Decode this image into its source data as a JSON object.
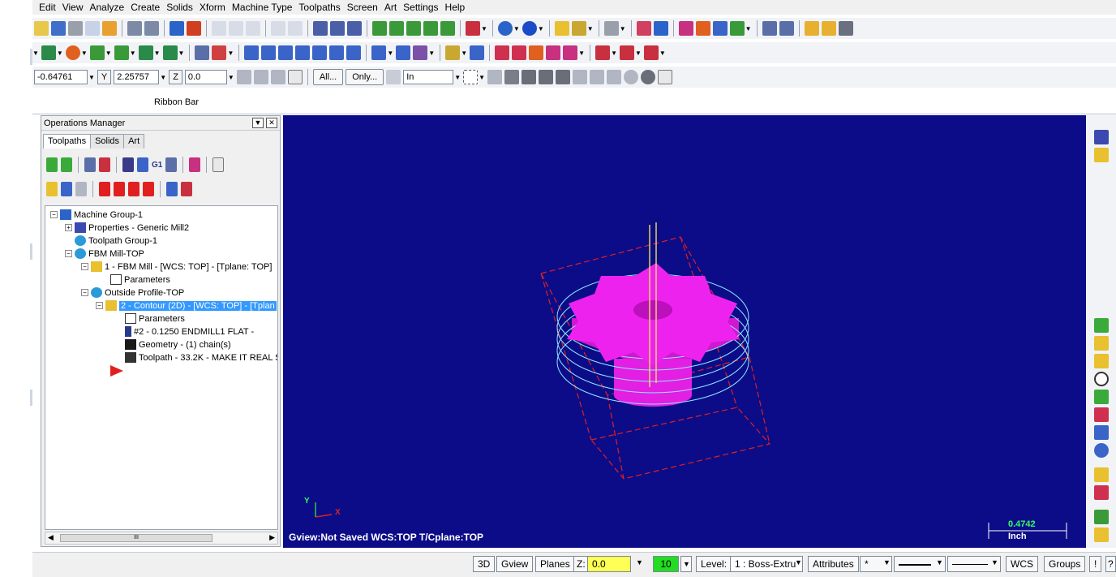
{
  "menu": [
    "Edit",
    "View",
    "Analyze",
    "Create",
    "Solids",
    "Xform",
    "Machine Type",
    "Toolpaths",
    "Screen",
    "Art",
    "Settings",
    "Help"
  ],
  "coords": {
    "x": "-0.64761",
    "y_label": "Y",
    "y": "2.25757",
    "z_label": "Z",
    "z": "0.0"
  },
  "ribbon": {
    "all_button": "All...",
    "only_button": "Only...",
    "select_mode": "In",
    "label": "Ribbon Bar"
  },
  "ops_manager": {
    "title": "Operations Manager",
    "tabs": [
      "Toolpaths",
      "Solids",
      "Art"
    ],
    "icon_g1": "G1",
    "tree": {
      "machine_group": "Machine Group-1",
      "properties": "Properties - Generic Mill2",
      "toolpath_group": "Toolpath Group-1",
      "fbm_mill_top": "FBM Mill-TOP",
      "op1": "1 - FBM Mill - [WCS: TOP] - [Tplane: TOP]",
      "op1_params": "Parameters",
      "outside_profile": "Outside Profile-TOP",
      "op2": "2 - Contour (2D) - [WCS: TOP] - [Tplan",
      "op2_params": "Parameters",
      "op2_tool": "#2 - 0.1250 ENDMILL1 FLAT -",
      "op2_geometry": "Geometry - (1) chain(s)",
      "op2_toolpath": "Toolpath - 33.2K - MAKE IT REAL S"
    },
    "scroll_mark": "III"
  },
  "viewport": {
    "gview": "Gview:Not Saved   WCS:TOP   T/Cplane:TOP",
    "axis_x": "X",
    "axis_y": "Y",
    "scale_value": "0.4742",
    "scale_unit": "Inch"
  },
  "status": {
    "btn_3d": "3D",
    "btn_gview": "Gview",
    "btn_planes": "Planes",
    "z_label": "Z:",
    "z_value": "0.0",
    "color_value": "10",
    "level_label": "Level:",
    "level_value": "1 : Boss-Extru",
    "attributes": "Attributes",
    "point_style": "*",
    "wcs": "WCS",
    "groups": "Groups",
    "bang": "!",
    "question": "?"
  },
  "colors": {
    "viewport_bg": "#0c0c88",
    "part_magenta": "#ee22ee",
    "toolpath_cyan": "#8fe6ff",
    "stock_red": "#e02020",
    "selection": "#3399ff"
  }
}
